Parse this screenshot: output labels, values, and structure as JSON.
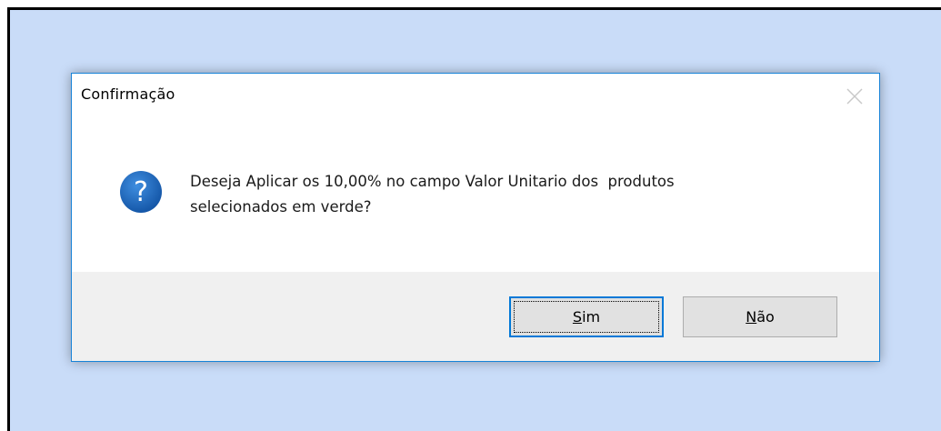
{
  "dialog": {
    "title": "Confirmação",
    "icon": "question-icon",
    "message": "Deseja Aplicar os 10,00% no campo Valor Unitario dos  produtos\nselecionados em verde?",
    "buttons": {
      "yes": {
        "mnemonic": "S",
        "rest": "im"
      },
      "no": {
        "mnemonic": "N",
        "rest": "ão"
      }
    },
    "close_icon": "close-icon"
  },
  "colors": {
    "desktop": "#c9dcf8",
    "dialog_border": "#1783d8",
    "icon_blue": "#1f6cc2",
    "button_face": "#e1e1e1",
    "button_focus": "#0078d7",
    "footer": "#f0f0f0"
  }
}
